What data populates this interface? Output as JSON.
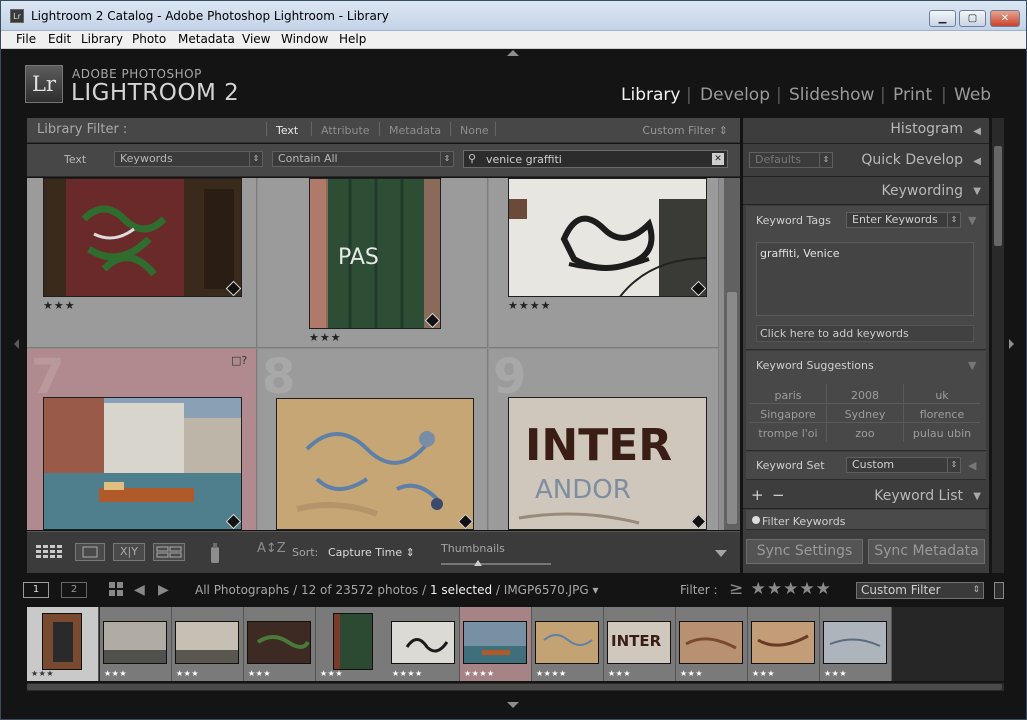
{
  "window": {
    "title": "Lightroom 2 Catalog - Adobe Photoshop Lightroom - Library",
    "app_icon": "Lr",
    "minimize": "▁",
    "maximize": "▢",
    "close": "✕"
  },
  "menu": [
    "File",
    "Edit",
    "Library",
    "Photo",
    "Metadata",
    "View",
    "Window",
    "Help"
  ],
  "brand": {
    "logo": "Lr",
    "line1": "ADOBE PHOTOSHOP",
    "line2": "LIGHTROOM 2"
  },
  "modules": [
    "Library",
    "Develop",
    "Slideshow",
    "Print",
    "Web"
  ],
  "active_module": "Library",
  "library_filter": {
    "title": "Library Filter :",
    "tabs": [
      "Text",
      "Attribute",
      "Metadata",
      "None"
    ],
    "active_tab": "Text",
    "preset": "Custom Filter",
    "row_label": "Text",
    "field_select": "Keywords",
    "rule_select": "Contain All",
    "search_value": "venice graffiti"
  },
  "grid": {
    "cells": [
      {
        "index": "",
        "stars": "★★★",
        "colors": [
          "#3a2a1c",
          "#6b2a2a",
          "#2f6d2f"
        ]
      },
      {
        "index": "",
        "stars": "★★★",
        "colors": [
          "#2d4d35",
          "#1f3a28",
          "#6b3a2a"
        ]
      },
      {
        "index": "",
        "stars": "★★★★",
        "colors": [
          "#e8e6e0",
          "#1c1c1c",
          "#a9a49a"
        ]
      },
      {
        "index": "7",
        "stars": "",
        "colors": [
          "#8aa0b4",
          "#4f7f8d",
          "#b05a2a"
        ]
      },
      {
        "index": "8",
        "stars": "",
        "colors": [
          "#c7a676",
          "#b4946a",
          "#5d7fa8"
        ]
      },
      {
        "index": "9",
        "stars": "",
        "colors": [
          "#cfc7bc",
          "#3a1e16",
          "#7c8ea0"
        ]
      }
    ],
    "overlay_icon": "□?"
  },
  "toolbar": {
    "sort_label": "Sort:",
    "sort_value": "Capture Time",
    "thumbnails_label": "Thumbnails",
    "sort_icon": "A↕Z"
  },
  "right_panel": {
    "histogram": "Histogram",
    "quick_develop": "Quick Develop",
    "qd_preset": "Defaults",
    "keywording": "Keywording",
    "keyword_tags_label": "Keyword Tags",
    "keyword_tags_mode": "Enter Keywords",
    "keywords_text": "graffiti, Venice",
    "add_keywords_hint": "Click here to add keywords",
    "keyword_suggestions": "Keyword Suggestions",
    "suggestions": [
      "paris",
      "2008",
      "uk",
      "Singapore",
      "Sydney",
      "florence",
      "trompe l'oi",
      "zoo",
      "pulau ubin"
    ],
    "keyword_set_label": "Keyword Set",
    "keyword_set_value": "Custom",
    "keyword_list": "Keyword List",
    "filter_keywords": "Filter Keywords",
    "add_icon": "+",
    "remove_icon": "−",
    "sync_settings": "Sync Settings",
    "sync_metadata": "Sync Metadata"
  },
  "filmstrip_bar": {
    "page1": "1",
    "page2": "2",
    "path_prefix": "All Photographs / 12 of 23572 photos /",
    "selected_text": "1 selected",
    "file": "/ IMGP6570.JPG",
    "filter_label": "Filter :",
    "rating_filter": "≥ ★★★★★",
    "custom_filter": "Custom Filter"
  },
  "filmstrip": [
    {
      "stars": "★★★",
      "colors": [
        "#7a4a30",
        "#2a2a2a"
      ]
    },
    {
      "stars": "★★★",
      "colors": [
        "#b0aca4",
        "#50504c"
      ]
    },
    {
      "stars": "★★★",
      "colors": [
        "#c6c0b4",
        "#5a5650"
      ]
    },
    {
      "stars": "★★★",
      "colors": [
        "#3d2a22",
        "#4a7a3a"
      ]
    },
    {
      "stars": "★★★",
      "colors": [
        "#2c4a32",
        "#7a3a2a"
      ]
    },
    {
      "stars": "★★★★",
      "colors": [
        "#dcdad4",
        "#1a1a1a"
      ]
    },
    {
      "stars": "★★★★",
      "colors": [
        "#7890a4",
        "#3f6f7a"
      ]
    },
    {
      "stars": "★★★★",
      "colors": [
        "#c3a274",
        "#5d7fa8"
      ]
    },
    {
      "stars": "★★★",
      "colors": [
        "#d0c8bc",
        "#3a1e16"
      ]
    },
    {
      "stars": "★★★",
      "colors": [
        "#b89270",
        "#7a4a30"
      ]
    },
    {
      "stars": "★★★",
      "colors": [
        "#c39c78",
        "#6a3a22"
      ]
    },
    {
      "stars": "★★★",
      "colors": [
        "#aeb4bc",
        "#5a6a80"
      ]
    }
  ]
}
